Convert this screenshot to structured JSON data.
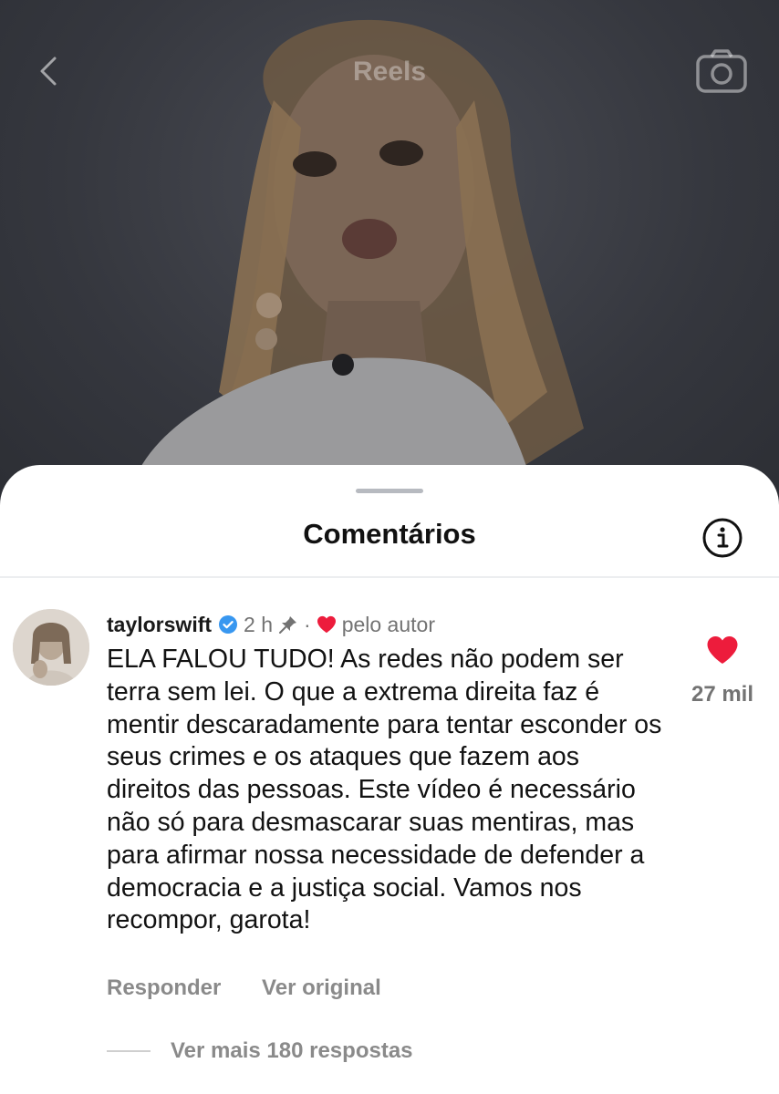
{
  "header": {
    "title": "Reels",
    "back_icon": "chevron-left-icon",
    "camera_icon": "camera-icon"
  },
  "sheet": {
    "title": "Comentários",
    "info_icon": "info-icon"
  },
  "comment": {
    "username": "taylorswift",
    "time": "2 h",
    "separator": "·",
    "liked_by_author": "pelo autor",
    "text": "ELA FALOU TUDO! As redes não podem ser terra sem lei. O que a extrema direita faz é mentir descaradamente para tentar esconder os seus crimes e os ataques que fazem aos direitos das pessoas. Este vídeo é necessário não só para desmascarar suas mentiras, mas para afirmar nossa necessidade de defender a democracia e a justiça social. Vamos nos recompor, garota!",
    "likes": "27 mil",
    "reply_label": "Responder",
    "original_label": "Ver original",
    "more_replies": "Ver mais 180 respostas"
  },
  "colors": {
    "like_red": "#ed1c3c",
    "verified_blue": "#3897f0",
    "muted_text": "#737373"
  }
}
